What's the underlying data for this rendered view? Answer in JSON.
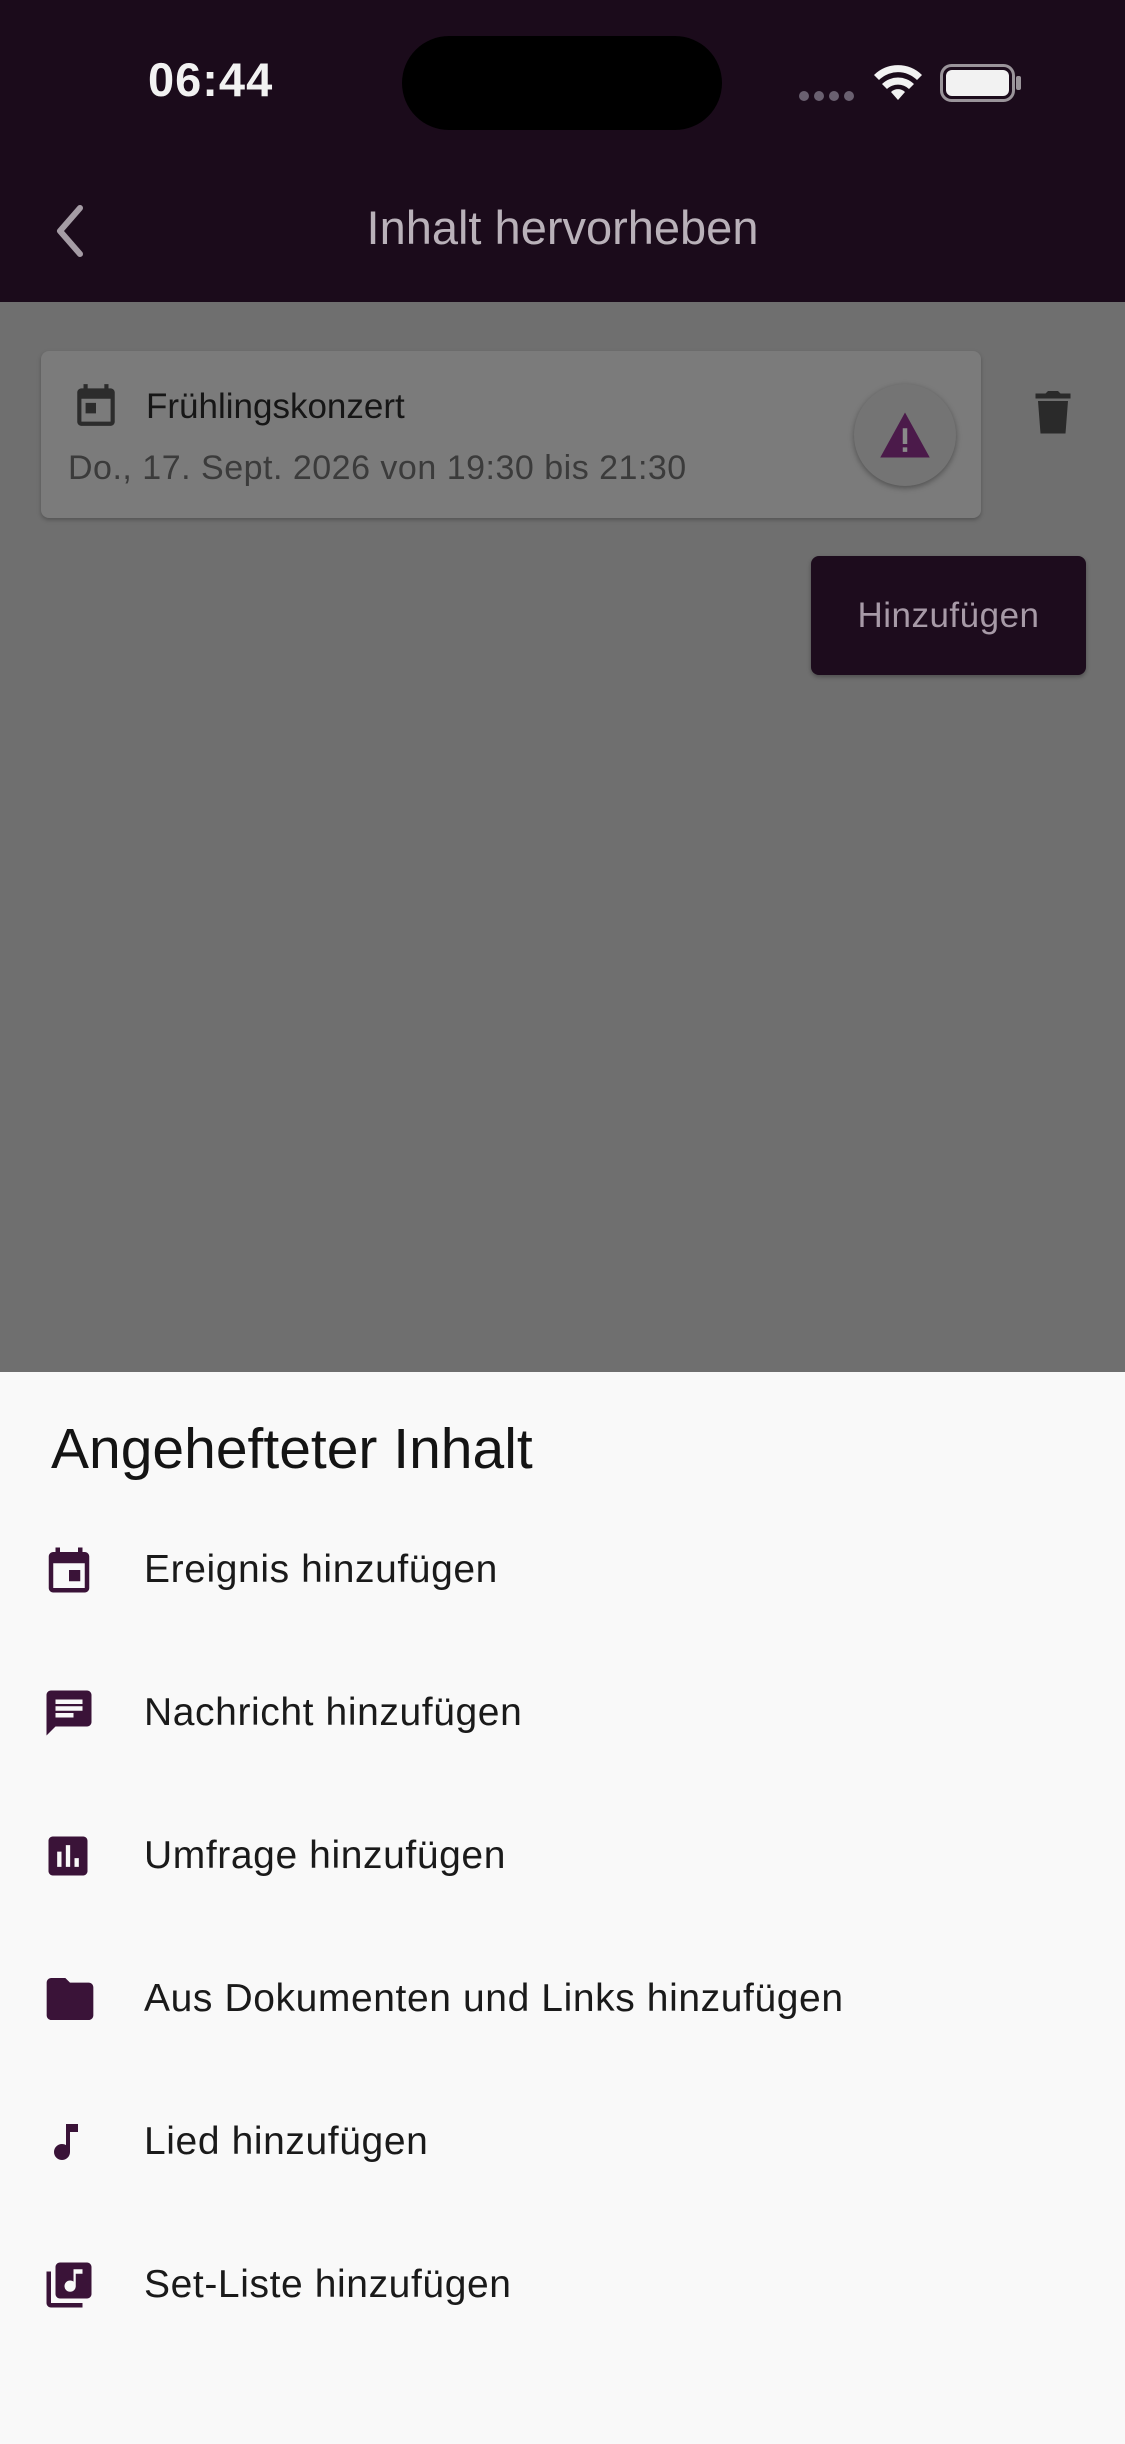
{
  "status_bar": {
    "time": "06:44"
  },
  "app_bar": {
    "title": "Inhalt hervorheben"
  },
  "card": {
    "title": "Frühlingskonzert",
    "date": "Do., 17. Sept. 2026 von 19:30 bis 21:30"
  },
  "add_button": {
    "label": "Hinzufügen"
  },
  "sheet": {
    "title": "Angehefteter Inhalt",
    "items": [
      {
        "label": "Ereignis hinzufügen",
        "icon": "calendar-event-icon"
      },
      {
        "label": "Nachricht hinzufügen",
        "icon": "message-icon"
      },
      {
        "label": "Umfrage hinzufügen",
        "icon": "poll-icon"
      },
      {
        "label": "Aus Dokumenten und Links hinzufügen",
        "icon": "folder-icon"
      },
      {
        "label": "Lied hinzufügen",
        "icon": "music-note-icon"
      },
      {
        "label": "Set-Liste hinzufügen",
        "icon": "library-music-icon"
      }
    ]
  },
  "colors": {
    "primary": "#3a1338",
    "app_bar_dimmed": "#1b0b1b",
    "scrim_background": "#6f6f6f",
    "sheet_background": "#f9f9f9",
    "warning_accent": "#4b1a4a"
  }
}
